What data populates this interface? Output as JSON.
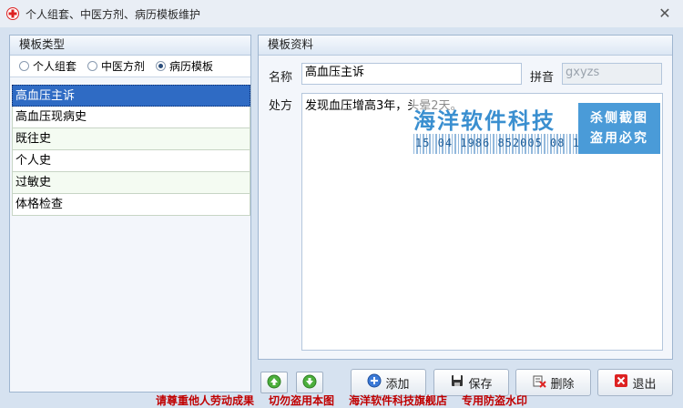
{
  "window": {
    "title": "个人组套、中医方剂、病历模板维护"
  },
  "left_panel": {
    "title": "模板类型",
    "radios": [
      {
        "label": "个人组套",
        "checked": false
      },
      {
        "label": "中医方剂",
        "checked": false
      },
      {
        "label": "病历模板",
        "checked": true
      }
    ],
    "items": [
      "高血压主诉",
      "高血压现病史",
      "既往史",
      "个人史",
      "过敏史",
      "体格检查"
    ],
    "selected_index": 0
  },
  "right_panel": {
    "title": "模板资料",
    "name_label": "名称",
    "name_value": "高血压主诉",
    "pinyin_label": "拼音",
    "pinyin_value": "gxyzs",
    "rx_label": "处方",
    "rx_value": "发现血压增高3年，头晕2天。"
  },
  "overlay_watermark": {
    "main": "海洋软件科技",
    "number": "15 04 1986 852005 08 10",
    "side_line1": "杀侧截图",
    "side_line2": "盗用必究"
  },
  "buttons": {
    "add": "添加",
    "save": "保存",
    "delete": "删除",
    "exit": "退出"
  },
  "bottom_watermark": [
    "请尊重他人劳动成果",
    "切勿盗用本图",
    "海洋软件科技旗舰店",
    "专用防盗水印"
  ]
}
